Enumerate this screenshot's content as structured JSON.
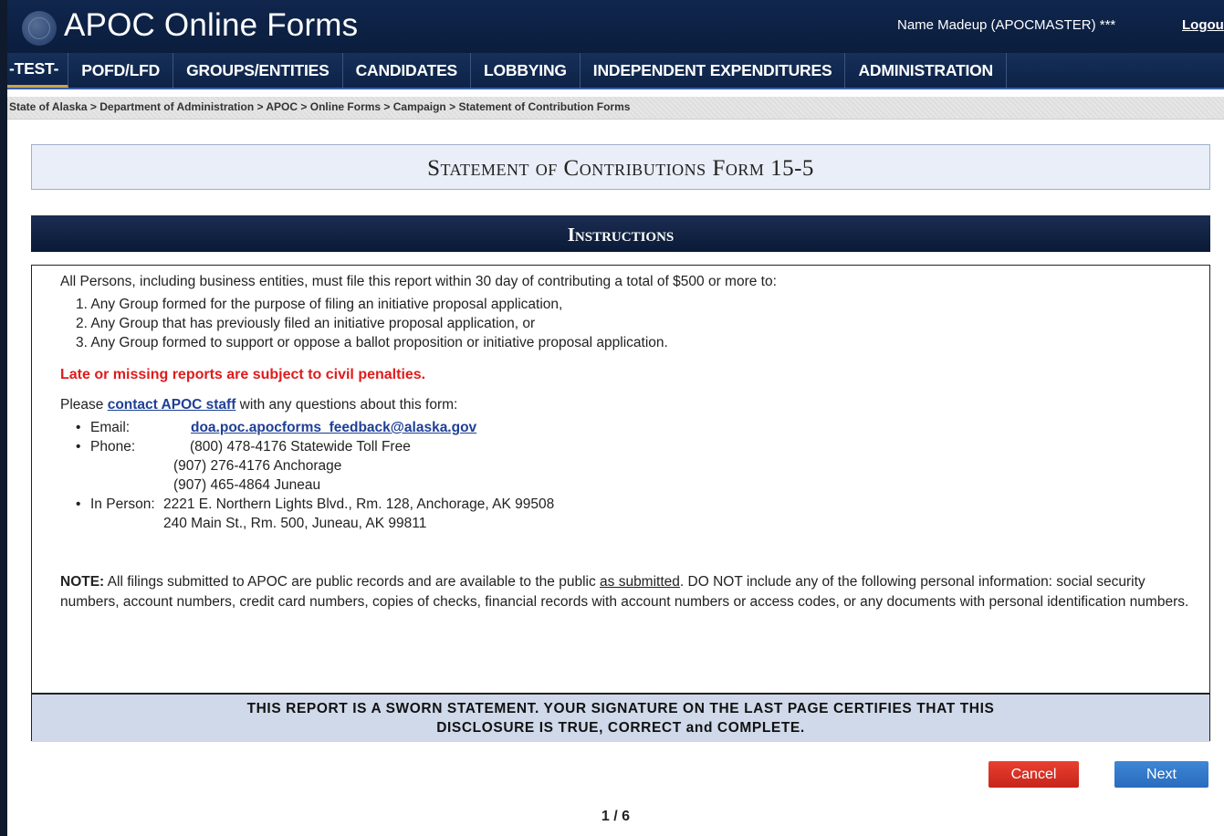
{
  "header": {
    "app_title": "APOC Online Forms",
    "user": "Name Madeup (APOCMASTER) ***",
    "logout": "Logou"
  },
  "nav": {
    "items": [
      "-TEST-",
      "POFD/LFD",
      "GROUPS/ENTITIES",
      "CANDIDATES",
      "LOBBYING",
      "INDEPENDENT EXPENDITURES",
      "ADMINISTRATION"
    ]
  },
  "breadcrumb": "State of Alaska > Department of Administration > APOC > Online Forms > Campaign > Statement of Contribution Forms",
  "form_title": "Statement of Contributions Form 15-5",
  "instructions": {
    "header": "Instructions",
    "intro": "All Persons, including business entities, must file this report within 30 day of contributing a total of $500 or more to:",
    "list": [
      "1.  Any Group formed for the purpose of filing an initiative proposal application,",
      "2.  Any Group that has previously filed an initiative proposal application, or",
      "3.  Any Group formed to support or oppose a ballot proposition or initiative proposal application."
    ],
    "warning": "Late or missing reports are subject to civil penalties.",
    "contact_prefix": "Please ",
    "contact_link": "contact APOC staff",
    "contact_suffix": " with any questions about this form:",
    "email_label": "Email:",
    "email": "doa.poc.apocforms_feedback@alaska.gov",
    "phone_label": "Phone:",
    "phones": [
      "(800) 478-4176 Statewide Toll Free",
      "(907) 276-4176 Anchorage",
      "(907) 465-4864 Juneau"
    ],
    "in_person_label": "In Person:",
    "addresses": [
      "2221 E. Northern Lights Blvd., Rm. 128, Anchorage, AK 99508",
      "240 Main St., Rm. 500, Juneau, AK 99811"
    ],
    "note_label": "NOTE:",
    "note_part1": " All filings submitted to APOC are public records and are available to the public ",
    "note_underlined": "as submitted",
    "note_part2": ". DO NOT include any of the following personal information: social security numbers, account numbers, credit card numbers, copies of checks, financial records with account numbers or access codes, or any documents with personal identification numbers.",
    "sworn_line1": "THIS REPORT IS A SWORN STATEMENT. YOUR SIGNATURE ON THE LAST PAGE CERTIFIES THAT THIS",
    "sworn_line2": "DISCLOSURE IS TRUE, CORRECT and COMPLETE."
  },
  "buttons": {
    "cancel": "Cancel",
    "next": "Next"
  },
  "pager": "1 / 6"
}
